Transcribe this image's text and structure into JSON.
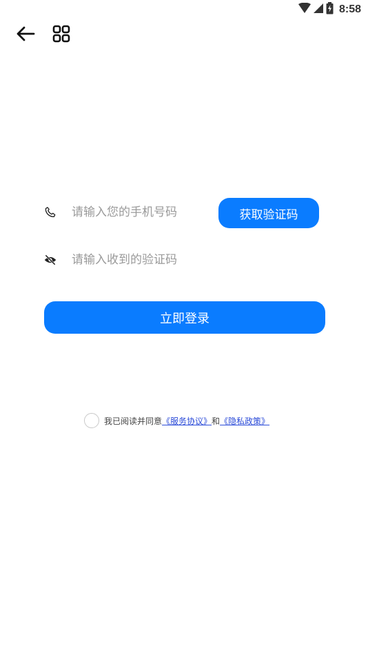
{
  "status_bar": {
    "time": "8:58",
    "icons": [
      "wifi-icon",
      "cell-signal-icon",
      "battery-icon"
    ]
  },
  "nav": {
    "icons": [
      "arrow-left-icon",
      "grid-icon"
    ]
  },
  "form": {
    "phone_placeholder": "请输入您的手机号码",
    "code_placeholder": "请输入收到的验证码",
    "get_code_label": "获取验证码",
    "login_label": "立即登录"
  },
  "agreement": {
    "prefix": "我已阅读并同意",
    "service_link": "《服务协议》",
    "conjunction": "和",
    "privacy_link": "《隐私政策》"
  },
  "colors": {
    "primary": "#0a7cff",
    "link": "#2b4bd8",
    "placeholder": "#9a9a9a"
  }
}
